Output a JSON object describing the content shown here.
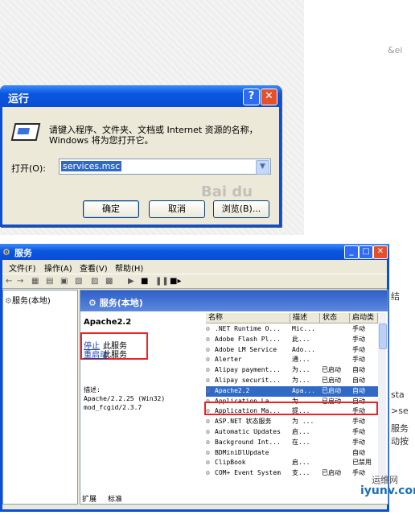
{
  "run_dialog": {
    "title": "运行",
    "description": "请键入程序、文件夹、文档或 Internet 资源的名称，Windows 将为您打开它。",
    "open_label": "打开(O):",
    "open_value": "services.msc",
    "ok": "确定",
    "cancel": "取消",
    "browse": "浏览(B)...",
    "watermark": "Bai du",
    "side_text": "&ei"
  },
  "services_window": {
    "title": "服务",
    "menus": [
      "文件(F)",
      "操作(A)",
      "查看(V)",
      "帮助(H)"
    ],
    "tree_item": "服务(本地)",
    "detail_header": "服务(本地)",
    "service_name": "Apache2.2",
    "stop_link": "停止",
    "stop_suffix": "此服务",
    "restart_link": "重启动",
    "restart_suffix": "此服务",
    "desc_label": "描述:",
    "desc_line1": "Apache/2.2.25 (Win32)",
    "desc_line2": "mod_fcgid/2.3.7",
    "columns": [
      "名称",
      "描述",
      "状态",
      "启动类"
    ],
    "rows": [
      {
        "name": ".NET Runtime O...",
        "desc": "Mic...",
        "status": "",
        "startup": "手动"
      },
      {
        "name": "Adobe Flash Pl...",
        "desc": "此...",
        "status": "",
        "startup": "手动"
      },
      {
        "name": "Adobe LM Service",
        "desc": "Ado...",
        "status": "",
        "startup": "手动"
      },
      {
        "name": "Alerter",
        "desc": "通...",
        "status": "",
        "startup": "手动"
      },
      {
        "name": "Alipay payment...",
        "desc": "为...",
        "status": "已启动",
        "startup": "自动"
      },
      {
        "name": "Alipay securit...",
        "desc": "为...",
        "status": "已启动",
        "startup": "自动"
      },
      {
        "name": "Apache2.2",
        "desc": "Apa...",
        "status": "已启动",
        "startup": "自动"
      },
      {
        "name": "Application La...",
        "desc": "为...",
        "status": "已启动",
        "startup": "自动"
      },
      {
        "name": "Application Ma...",
        "desc": "提...",
        "status": "",
        "startup": "手动"
      },
      {
        "name": "ASP.NET 状态服务",
        "desc": "为 ...",
        "status": "",
        "startup": "手动"
      },
      {
        "name": "Automatic Updates",
        "desc": "启...",
        "status": "",
        "startup": "手动"
      },
      {
        "name": "Background Int...",
        "desc": "在...",
        "status": "",
        "startup": "手动"
      },
      {
        "name": "BDMiniDlUpdate",
        "desc": "",
        "status": "",
        "startup": "自动"
      },
      {
        "name": "ClipBook",
        "desc": "启...",
        "status": "",
        "startup": "已禁用"
      },
      {
        "name": "COM+ Event System",
        "desc": "支...",
        "status": "已启动",
        "startup": "手动"
      }
    ],
    "selected_row": 6,
    "tab_extended": "扩展",
    "tab_standard": "标准"
  },
  "side_fragments": [
    "结",
    "sta",
    ">se",
    "服务",
    "动按"
  ],
  "site_cn": "运维网",
  "site": "iyunv.com"
}
